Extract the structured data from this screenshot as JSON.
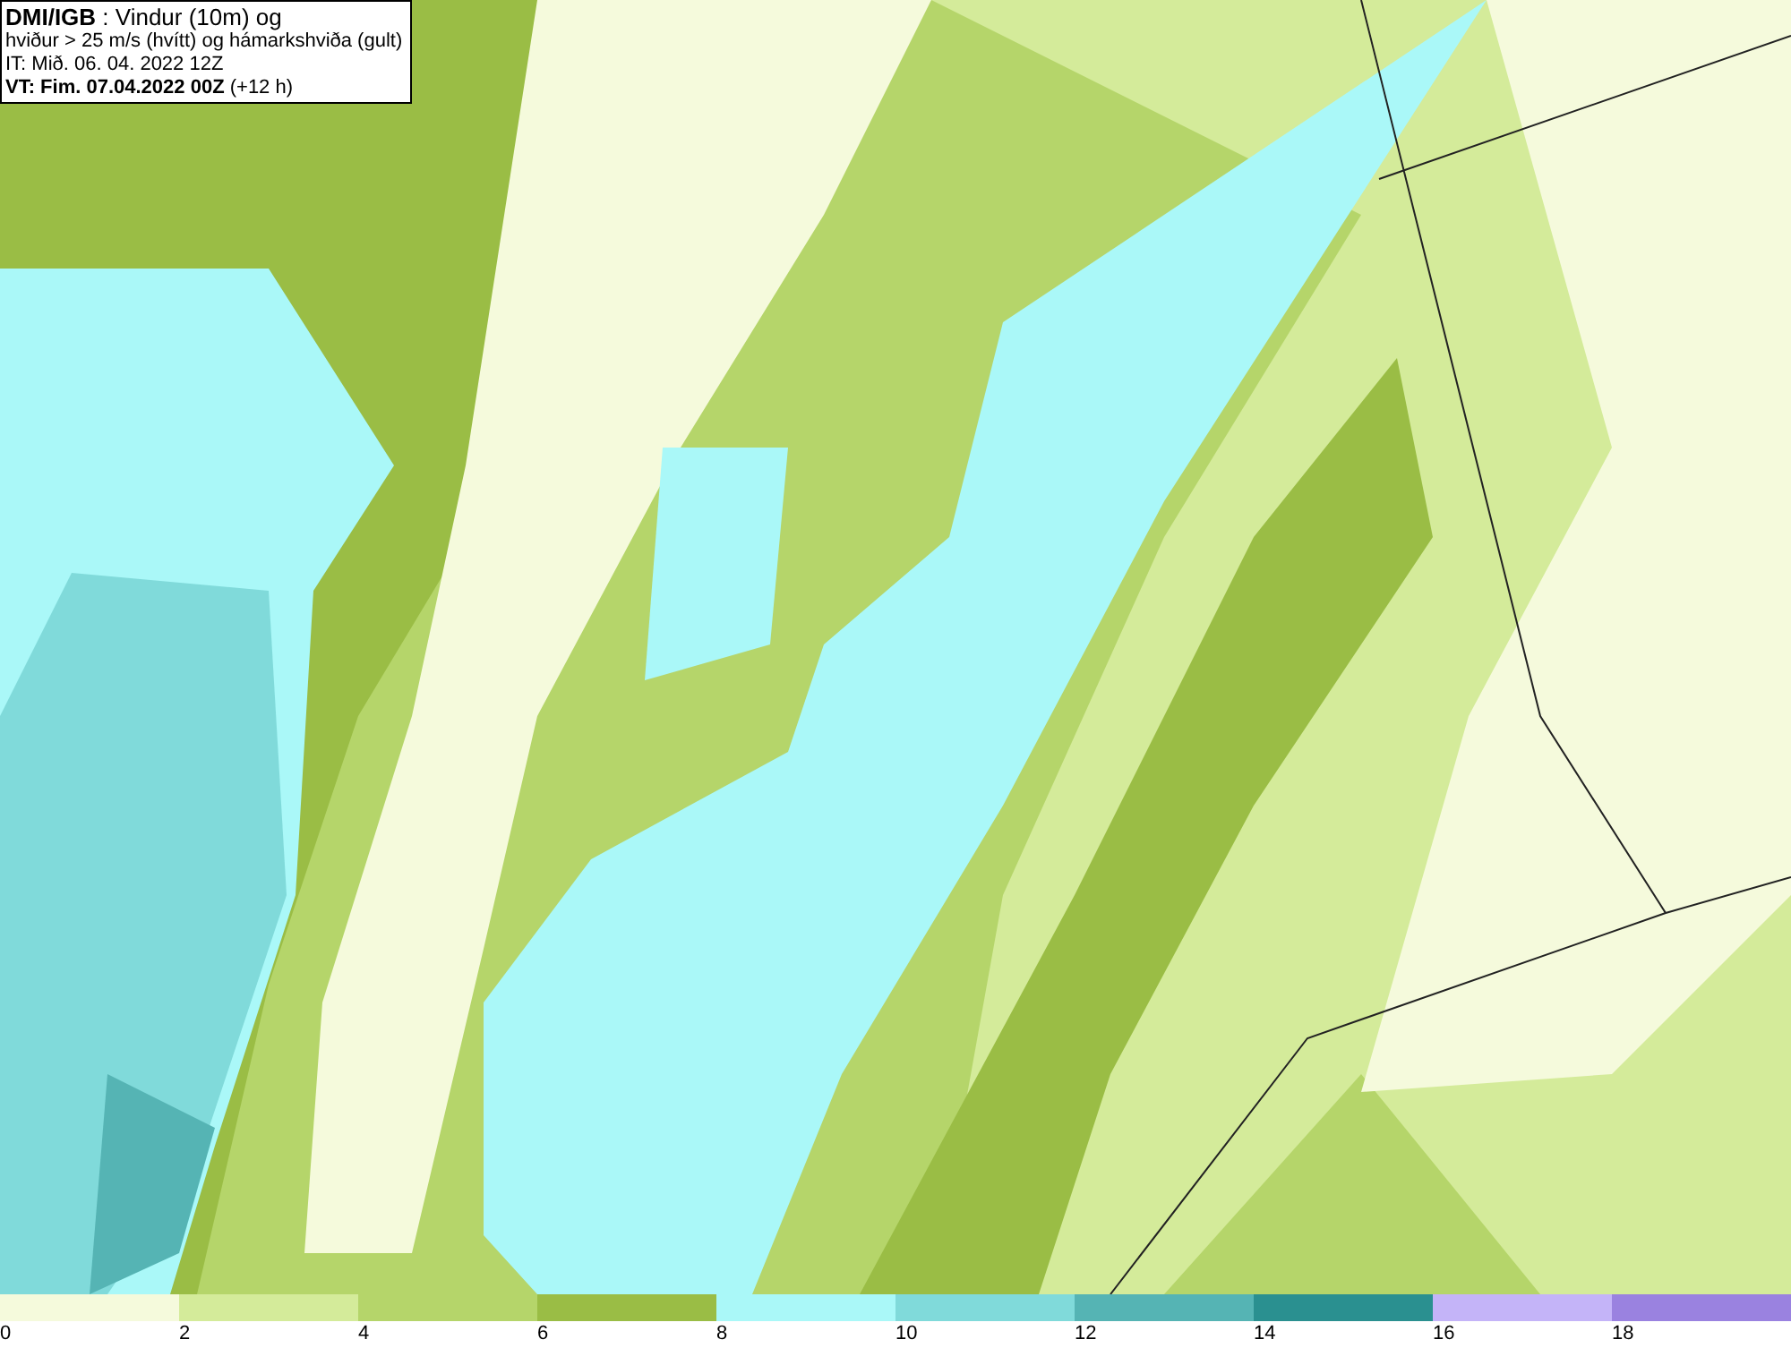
{
  "title_box": {
    "lines": [
      "**DMI/IGB** : Vindur (10m) og",
      "hviður > 25 m/s (hvítt) og hámarkshviða (gult)",
      "IT: Mið. 06. 04. 2022 12Z",
      "**VT: Fim. 07.04.2022 00Z** (+12 h)"
    ]
  },
  "legend": [
    {
      "label": "0",
      "color": "#f5fadc"
    },
    {
      "label": "2",
      "color": "#d4eb9a"
    },
    {
      "label": "4",
      "color": "#b5d56a"
    },
    {
      "label": "6",
      "color": "#9abd45"
    },
    {
      "label": "8",
      "color": "#aaf8f8"
    },
    {
      "label": "10",
      "color": "#80dada"
    },
    {
      "label": "12",
      "color": "#55b4b4"
    },
    {
      "label": "14",
      "color": "#2a9090"
    },
    {
      "label": "16",
      "color": "#c4b4f8"
    },
    {
      "label": "18",
      "color": "#9a82e0"
    }
  ]
}
